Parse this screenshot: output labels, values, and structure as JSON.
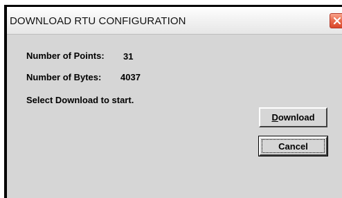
{
  "window": {
    "title": "DOWNLOAD RTU CONFIGURATION",
    "close_icon": "close-icon"
  },
  "info": {
    "points_label": "Number of Points:",
    "points_value": "31",
    "bytes_label": "Number of Bytes:",
    "bytes_value": "4037",
    "instruction": "Select Download to start."
  },
  "buttons": {
    "download_mnemonic": "D",
    "download_rest": "ownload",
    "cancel_label": "Cancel"
  },
  "colors": {
    "dialog_bg": "#d6d6d6",
    "close_button": "#e86a4c"
  }
}
